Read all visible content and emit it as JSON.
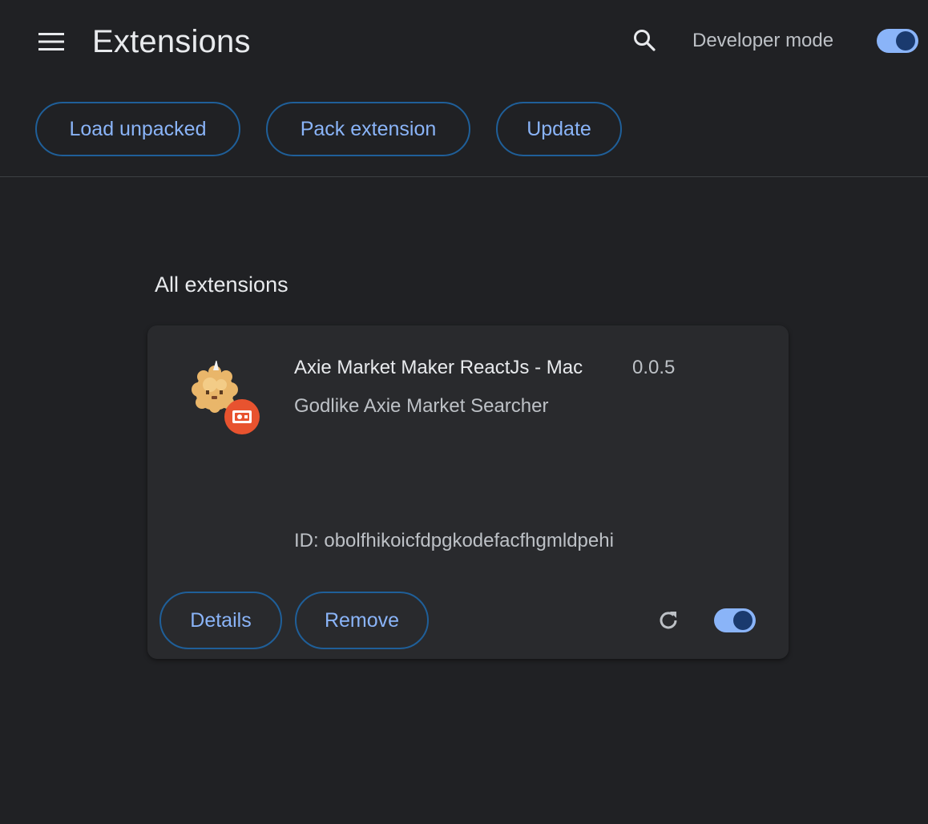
{
  "header": {
    "title": "Extensions",
    "developer_mode_label": "Developer mode",
    "developer_mode_on": true,
    "icons": {
      "menu": "hamburger-menu-icon",
      "search": "search-icon"
    }
  },
  "toolbar": {
    "load_unpacked": "Load unpacked",
    "pack_extension": "Pack extension",
    "update": "Update"
  },
  "section": {
    "title": "All extensions"
  },
  "extensions": [
    {
      "name": "Axie Market Maker ReactJs - Mac",
      "version": "0.0.5",
      "description": "Godlike Axie Market Searcher",
      "id_label": "ID:",
      "id": "obolfhikoicfdpgkodefacfhgmldpehi",
      "details_label": "Details",
      "remove_label": "Remove",
      "enabled": true,
      "icon": "axie-creature-icon",
      "badge_icon": "unpacked-extension-badge-icon"
    }
  ],
  "colors": {
    "background": "#202124",
    "card": "#292a2d",
    "accent": "#8ab4f8",
    "button_border": "#1f5f99",
    "badge": "#e8532f"
  }
}
